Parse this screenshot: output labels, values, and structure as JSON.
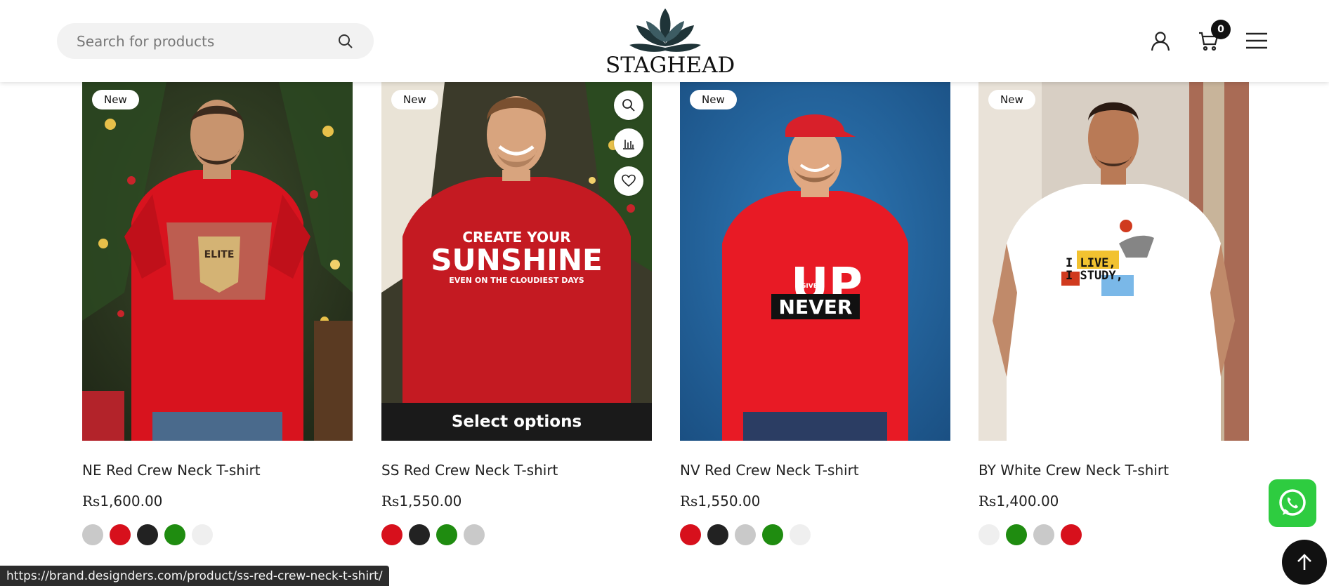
{
  "header": {
    "search_placeholder": "Search for products",
    "logo_text": "STAGHEAD",
    "cart_count": "0"
  },
  "products": [
    {
      "badge": "New",
      "title": "NE Red Crew Neck T-shirt",
      "currency": "Rs",
      "price": "1,600.00",
      "shirt_color": "#d8131e",
      "background": "christmas-tree",
      "swatches": [
        "#c9c9c9",
        "#d7101c",
        "#222222",
        "#1f8c10",
        "#efefef"
      ]
    },
    {
      "badge": "New",
      "title": "SS Red Crew Neck T-shirt",
      "currency": "Rs",
      "price": "1,550.00",
      "print_line1": "CREATE YOUR",
      "print_line2": "SUNSHINE",
      "print_line3": "EVEN ON THE CLOUDIEST DAYS",
      "select_options": "Select options",
      "shirt_color": "#c41a22",
      "background": "christmas-tree",
      "swatches": [
        "#d7101c",
        "#222222",
        "#1f8c10",
        "#c9c9c9"
      ]
    },
    {
      "badge": "New",
      "title": "NV Red Crew Neck T-shirt",
      "currency": "Rs",
      "price": "1,550.00",
      "print_text": "NEVER",
      "print_small": "GIVE",
      "print_big": "UP",
      "shirt_color": "#e81a25",
      "background": "blue-wall",
      "swatches": [
        "#d7101c",
        "#222222",
        "#c9c9c9",
        "#1f8c10",
        "#efefef"
      ]
    },
    {
      "badge": "New",
      "title": "BY White Crew Neck T-shirt",
      "currency": "Rs",
      "price": "1,400.00",
      "print_line1": "I LIVE,",
      "print_line2": "I STUDY,",
      "shirt_color": "#ffffff",
      "background": "street",
      "swatches": [
        "#efefef",
        "#1f8c10",
        "#c9c9c9",
        "#d7101c"
      ]
    }
  ],
  "status_url": "https://brand.designders.com/product/ss-red-crew-neck-t-shirt/",
  "icons": [
    "search-icon",
    "user-icon",
    "cart-icon",
    "menu-icon",
    "zoom-icon",
    "compare-icon",
    "wishlist-icon",
    "whatsapp-icon",
    "arrow-up-icon"
  ]
}
